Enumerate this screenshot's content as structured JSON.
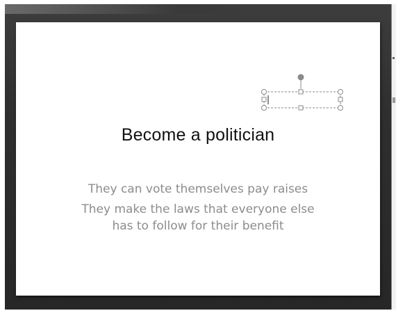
{
  "slide": {
    "title": "Become a politician",
    "bullets": [
      "They can vote themselves pay raises",
      "They make the laws that everyone else has to follow for their benefit"
    ]
  },
  "selection_box": {
    "icon": "text-box-selection-handles"
  },
  "colors": {
    "workspace": "#2f2f2f",
    "slide_background": "#ffffff",
    "title_text": "#111111",
    "body_text": "#8c8c8c",
    "handle": "#8a8a8a"
  }
}
